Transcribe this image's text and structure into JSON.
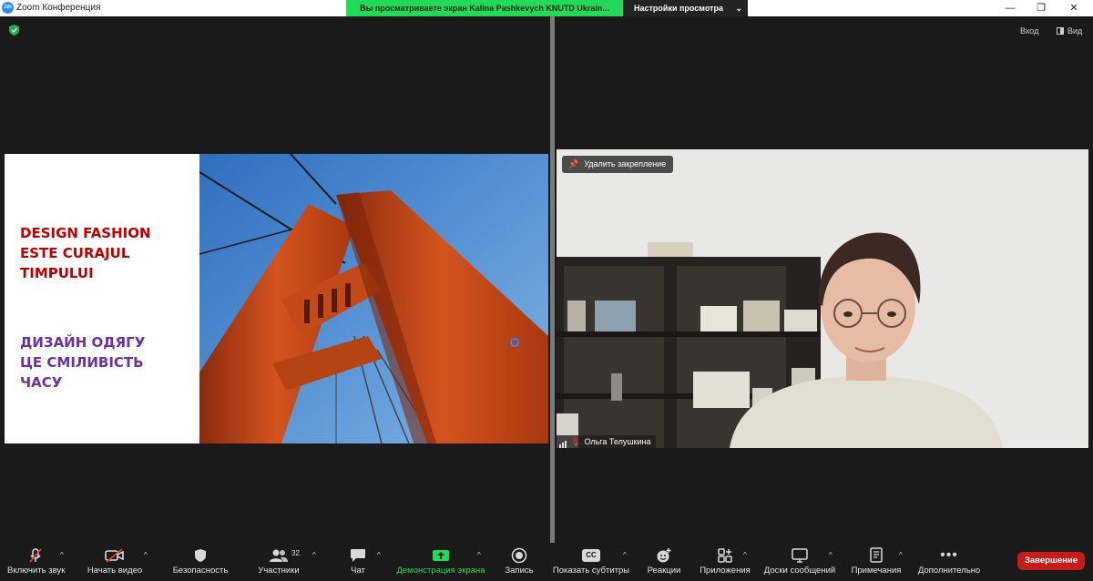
{
  "window": {
    "title": "Zoom Конференция",
    "share_banner": "Вы просматриваете экран Kalina Pashkevych KNUTD Ukrain...",
    "view_settings": "Настройки просмотра",
    "minimize": "—",
    "restore": "❐",
    "close": "✕"
  },
  "top_buttons": {
    "exit": "Вход",
    "view": "Вид"
  },
  "slide": {
    "title_en": "DESIGN FASHION ESTE CURAJUL TIMPULUI",
    "title_ua": " ДИЗАЙН ОДЯГУ\nЦЕ СМІЛИВІСТЬ\nЧАСУ",
    "colors": {
      "en": "#c00000",
      "ua": "#7030a0"
    }
  },
  "video": {
    "unpin_label": "Удалить закрепление",
    "participant_name": "Ольга Телушкина"
  },
  "toolbar": {
    "mute": "Включить звук",
    "video": "Начать видео",
    "security": "Безопасность",
    "participants": "Участники",
    "participants_count": "32",
    "chat": "Чат",
    "share": "Демонстрация экрана",
    "record": "Запись",
    "captions": "Показать субтитры",
    "captions_icon_text": "CC",
    "reactions": "Реакции",
    "apps": "Приложения",
    "whiteboards": "Доски сообщений",
    "notes": "Примечания",
    "more": "Дополнительно",
    "end": "Завершение",
    "share_color": "#23d959",
    "end_color": "#c51b1b"
  }
}
